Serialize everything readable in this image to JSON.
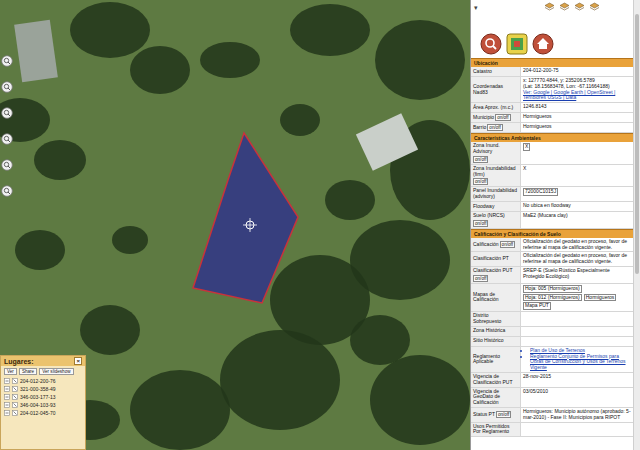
{
  "panel": {
    "collapse": "▾",
    "sections": [
      {
        "title": "Ubicación",
        "rows": [
          {
            "label": "Catastro",
            "toggle": null,
            "kind": "text",
            "lines": [
              "204-012-200-75"
            ],
            "links": []
          },
          {
            "label": "Coordenadas Nad83",
            "toggle": null,
            "kind": "text",
            "lines": [
              "x: 127770.4844, y: 235206.5789",
              "(Lat: 18.15683478, Lon: -67.11664188)"
            ],
            "links": [
              "Ver: Google | Google Earth | OpenStreet | Temblores USGS | Data"
            ]
          },
          {
            "label": "Área Aprox. (m.c.)",
            "toggle": null,
            "kind": "text",
            "lines": [
              "1246.8143"
            ],
            "links": []
          },
          {
            "label": "Municipio",
            "toggle": "on/off",
            "kind": "text",
            "lines": [
              "Hormigueros"
            ],
            "links": []
          },
          {
            "label": "Barrio",
            "toggle": "on/off",
            "kind": "text",
            "lines": [
              "Hormigueros"
            ],
            "links": []
          }
        ]
      },
      {
        "title": "Características Ambientales",
        "rows": [
          {
            "label": "Zona Inund. Advisory",
            "toggle": "on/off",
            "kind": "box",
            "lines": [
              "X"
            ],
            "links": []
          },
          {
            "label": "Zona Inundabilidad (firm)",
            "toggle": "on/off",
            "kind": "text",
            "lines": [
              "X"
            ],
            "links": []
          },
          {
            "label": "Panel Inundabilidad (advisory)",
            "toggle": null,
            "kind": "box",
            "lines": [
              "72000C1015J"
            ],
            "links": []
          },
          {
            "label": "Floodway",
            "toggle": null,
            "kind": "text",
            "lines": [
              "No ubica en floodway"
            ],
            "links": []
          },
          {
            "label": "Suelo (NRCS)",
            "toggle": "on/off",
            "kind": "text",
            "lines": [
              "MaE2 (Mucara clay)"
            ],
            "links": []
          }
        ]
      },
      {
        "title": "Calificación y Clasificación de Suelo",
        "rows": [
          {
            "label": "Calificación",
            "toggle": "on/off",
            "kind": "text",
            "lines": [
              "Oficialización del geodato en proceso, favor de referirse al mapa de calificación vigente."
            ],
            "links": []
          },
          {
            "label": "Clasificación PT",
            "toggle": null,
            "kind": "text",
            "lines": [
              "Oficialización del geodato en proceso, favor de referirse al mapa de calificación vigente."
            ],
            "links": []
          },
          {
            "label": "Clasificación PUT",
            "toggle": "on/off",
            "kind": "text",
            "lines": [
              "SREP-E (Suelo Rústico Especialmente Protegido Ecológico)"
            ],
            "links": []
          },
          {
            "label": "Mapas de Calificación",
            "toggle": null,
            "kind": "box",
            "lines": [
              "Hoja: 005 (Hormigueros)",
              "Hoja: 012 (Hormigueros)",
              "Hormigueros",
              "Mapa PUT"
            ],
            "links": []
          },
          {
            "label": "Distrito Sobrepuesto",
            "toggle": null,
            "kind": "text",
            "lines": [],
            "links": []
          },
          {
            "label": "Zona Histórica",
            "toggle": null,
            "kind": "text",
            "lines": [],
            "links": []
          },
          {
            "label": "Sitio Histórico",
            "toggle": null,
            "kind": "text",
            "lines": [],
            "links": []
          },
          {
            "label": "Reglamento Aplicable",
            "toggle": null,
            "kind": "bullets",
            "lines": [
              "Plan de Uso de Terrenos",
              "Reglamento Conjunto de Permisos para Obras de Construcción y Usos de Terrenos Vigente"
            ],
            "links": []
          },
          {
            "label": "Vigencia de Clasificación PUT",
            "toggle": null,
            "kind": "text",
            "lines": [
              "28-nov-2015"
            ],
            "links": []
          },
          {
            "label": "Vigencia de GeoDato de Calificación",
            "toggle": null,
            "kind": "text",
            "lines": [
              "03/05/2010"
            ],
            "links": []
          },
          {
            "label": "Status PT",
            "toggle": "on/off",
            "kind": "text",
            "lines": [
              "Hormigueros: Municipio autónomo (aprobado: 5-mar-2010) - Fase II: Municipios para RIPOT"
            ],
            "links": []
          },
          {
            "label": "Usos Permitidos Por Reglamento",
            "toggle": null,
            "kind": "text",
            "lines": [],
            "links": []
          }
        ]
      }
    ]
  },
  "lugares": {
    "title": "Lugares:",
    "close": "×",
    "buttons": [
      "Ver",
      "Share",
      "Ver slideshow"
    ],
    "items": [
      "204-012-200-76",
      "321-000-358-49",
      "346-003-177-13",
      "346-004-103-93",
      "204-012-045-70"
    ]
  }
}
